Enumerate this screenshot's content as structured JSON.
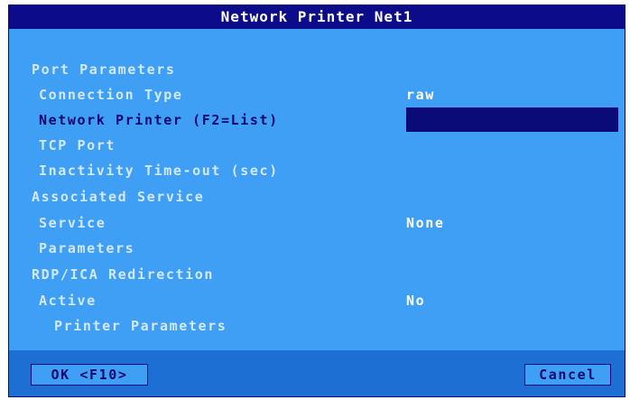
{
  "window": {
    "title": "Network Printer Net1"
  },
  "form": {
    "port_section": "Port Parameters",
    "connection_type_label": "Connection Type",
    "connection_type_value": "raw",
    "network_printer_label": "Network Printer (F2=List)",
    "network_printer_value": "",
    "tcp_port_label": "TCP Port",
    "inactivity_label": "Inactivity Time-out (sec)",
    "service_section": "Associated Service",
    "service_label": "Service",
    "service_value": "None",
    "parameters_label": "Parameters",
    "rdp_section": "RDP/ICA Redirection",
    "active_label": "Active",
    "active_value": "No",
    "printer_parameters_label": "Printer Parameters"
  },
  "buttons": {
    "ok": "OK <F10>",
    "cancel": "Cancel"
  },
  "colors": {
    "background": "#3f9ff5",
    "title_bar": "#0c0c8a",
    "footer": "#1e6fd3",
    "input_focus": "#0a0a78"
  }
}
